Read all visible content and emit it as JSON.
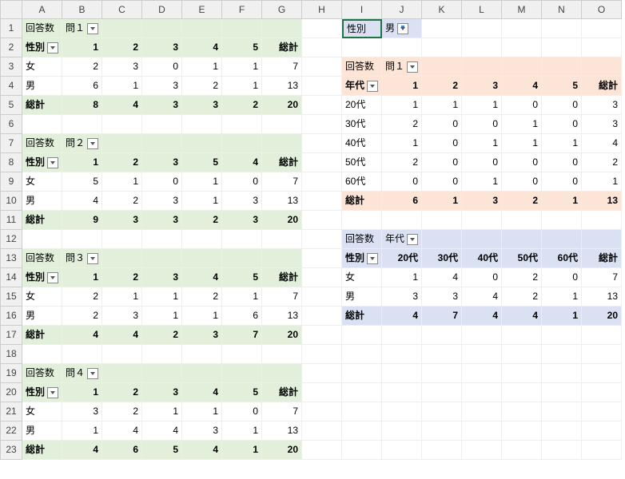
{
  "columns": [
    "A",
    "B",
    "C",
    "D",
    "E",
    "F",
    "G",
    "H",
    "I",
    "J",
    "K",
    "L",
    "M",
    "N",
    "O"
  ],
  "rows": 23,
  "labels": {
    "count": "回答数",
    "sex": "性別",
    "age": "年代",
    "total": "総計",
    "male": "男",
    "female": "女",
    "q1": "問１",
    "q2": "問２",
    "q3": "問３",
    "q4": "問４"
  },
  "pivots": {
    "p1": {
      "title": "問１",
      "hdr": [
        "1",
        "2",
        "3",
        "4",
        "5",
        "総計"
      ],
      "rows": [
        [
          "女",
          "2",
          "3",
          "0",
          "1",
          "1",
          "7"
        ],
        [
          "男",
          "6",
          "1",
          "3",
          "2",
          "1",
          "13"
        ],
        [
          "総計",
          "8",
          "4",
          "3",
          "3",
          "2",
          "20"
        ]
      ]
    },
    "p2": {
      "title": "問２",
      "hdr": [
        "1",
        "2",
        "3",
        "5",
        "4",
        "総計"
      ],
      "rows": [
        [
          "女",
          "5",
          "1",
          "0",
          "1",
          "0",
          "7"
        ],
        [
          "男",
          "4",
          "2",
          "3",
          "1",
          "3",
          "13"
        ],
        [
          "総計",
          "9",
          "3",
          "3",
          "2",
          "3",
          "20"
        ]
      ]
    },
    "p3": {
      "title": "問３",
      "hdr": [
        "1",
        "2",
        "3",
        "4",
        "5",
        "総計"
      ],
      "rows": [
        [
          "女",
          "2",
          "1",
          "1",
          "2",
          "1",
          "7"
        ],
        [
          "男",
          "2",
          "3",
          "1",
          "1",
          "6",
          "13"
        ],
        [
          "総計",
          "4",
          "4",
          "2",
          "3",
          "7",
          "20"
        ]
      ]
    },
    "p4": {
      "title": "問４",
      "hdr": [
        "1",
        "2",
        "3",
        "4",
        "5",
        "総計"
      ],
      "rows": [
        [
          "女",
          "3",
          "2",
          "1",
          "1",
          "0",
          "7"
        ],
        [
          "男",
          "1",
          "4",
          "4",
          "3",
          "1",
          "13"
        ],
        [
          "総計",
          "4",
          "6",
          "5",
          "4",
          "1",
          "20"
        ]
      ]
    },
    "p5": {
      "title": "問１",
      "hdr": [
        "1",
        "2",
        "3",
        "4",
        "5",
        "総計"
      ],
      "rows": [
        [
          "20代",
          "1",
          "1",
          "1",
          "0",
          "0",
          "3"
        ],
        [
          "30代",
          "2",
          "0",
          "0",
          "1",
          "0",
          "3"
        ],
        [
          "40代",
          "1",
          "0",
          "1",
          "1",
          "1",
          "4"
        ],
        [
          "50代",
          "2",
          "0",
          "0",
          "0",
          "0",
          "2"
        ],
        [
          "60代",
          "0",
          "0",
          "1",
          "0",
          "0",
          "1"
        ],
        [
          "総計",
          "6",
          "1",
          "3",
          "2",
          "1",
          "13"
        ]
      ]
    },
    "p6": {
      "title": "年代",
      "hdr": [
        "20代",
        "30代",
        "40代",
        "50代",
        "60代",
        "総計"
      ],
      "rows": [
        [
          "女",
          "1",
          "4",
          "0",
          "2",
          "0",
          "7"
        ],
        [
          "男",
          "3",
          "3",
          "4",
          "2",
          "1",
          "13"
        ],
        [
          "総計",
          "4",
          "7",
          "4",
          "4",
          "1",
          "20"
        ]
      ]
    }
  },
  "filter": {
    "field": "性別",
    "value": "男"
  }
}
